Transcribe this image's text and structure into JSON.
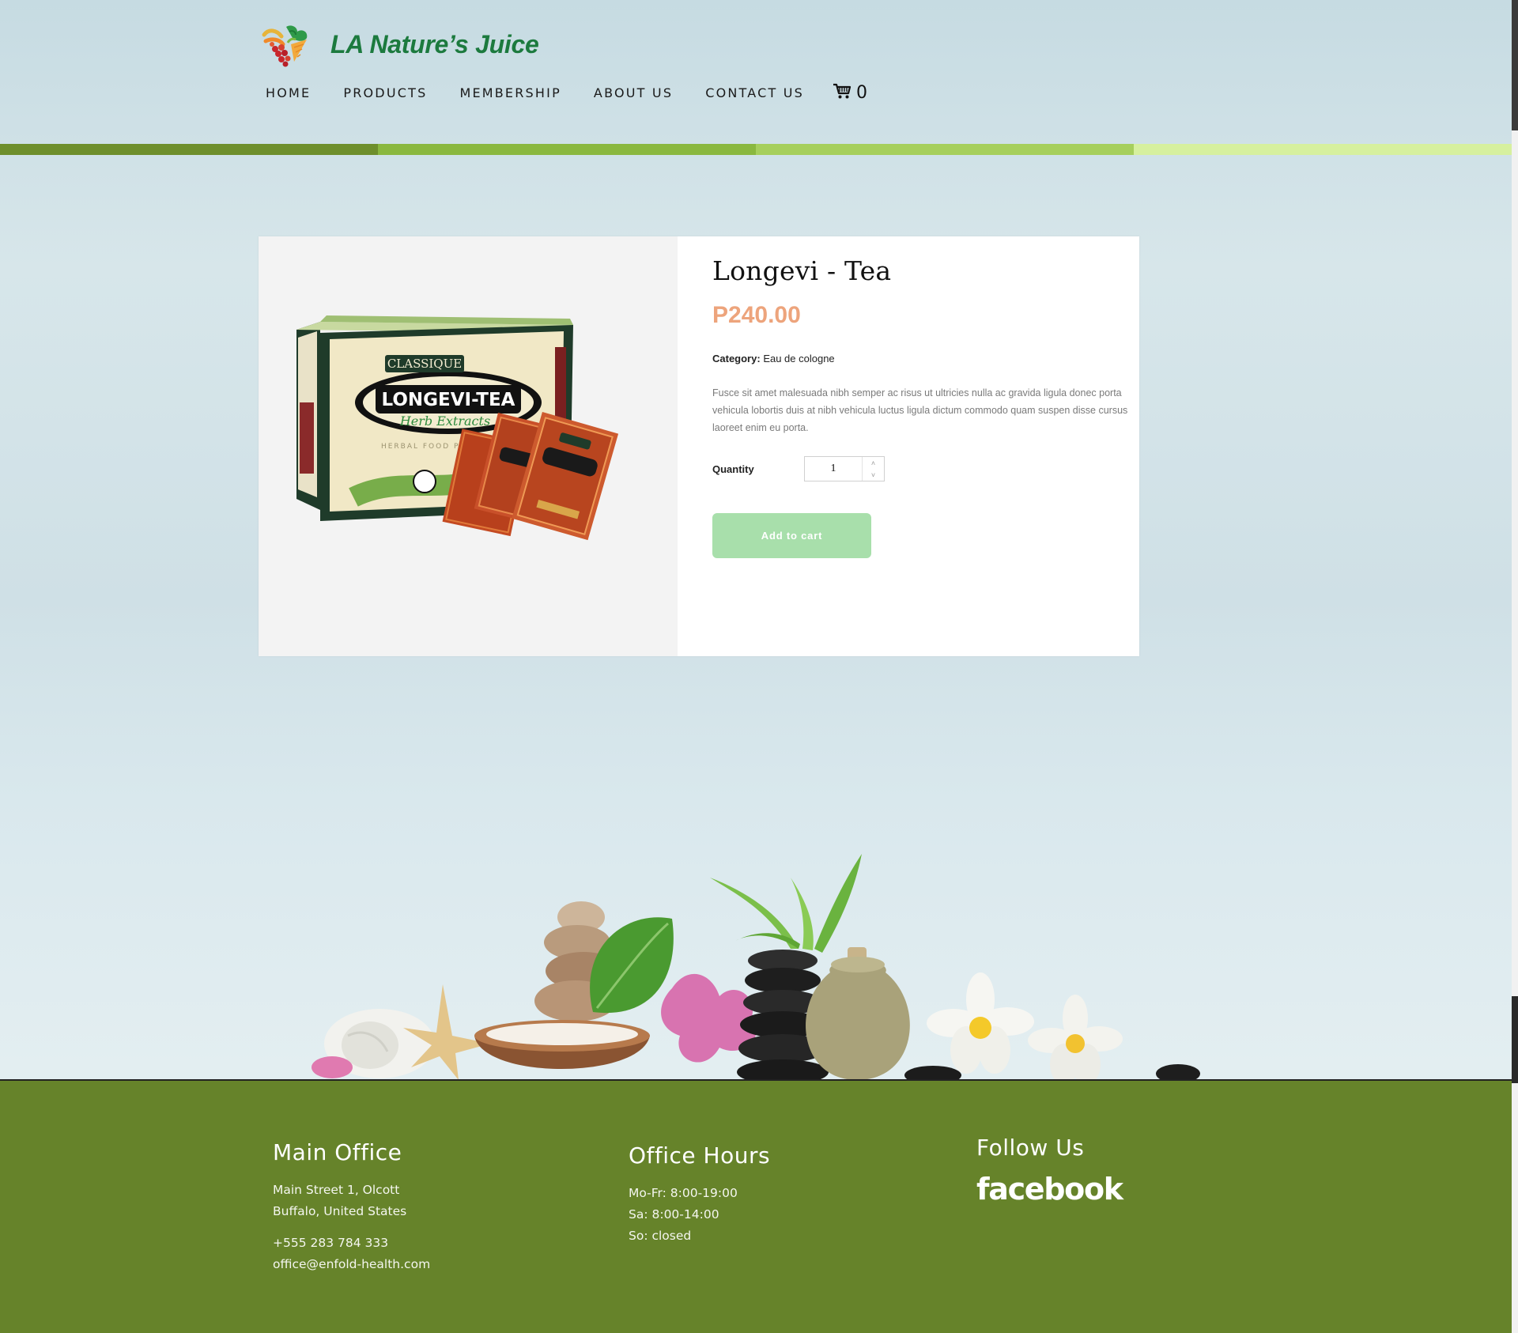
{
  "brand": {
    "name": "LA Nature’s Juice",
    "logo_icon": "fruit-heart-logo"
  },
  "nav": {
    "items": [
      {
        "label": "HOME"
      },
      {
        "label": "PRODUCTS"
      },
      {
        "label": "MEMBERSHIP"
      },
      {
        "label": "ABOUT US"
      },
      {
        "label": "CONTACT US"
      }
    ],
    "cart_icon": "cart-icon",
    "cart_count": "0"
  },
  "colors": {
    "stripe": [
      "#6e8f2c",
      "#8ab83f",
      "#a6cf5c",
      "#d6f09e"
    ],
    "price": "#eda47c",
    "button": "#a8dfab",
    "footer": "#66832a",
    "brand": "#1c7a3e"
  },
  "product": {
    "image_text": {
      "brand": "CLASSIQUE",
      "name": "LONGEVI-TEA",
      "subtitle": "Herb Extracts",
      "line": "HERBAL FOOD PRODUCT"
    },
    "title": "Longevi - Tea",
    "price": "P240.00",
    "category_label": "Category:",
    "category_value": "Eau de cologne",
    "description": "Fusce sit amet malesuada nibh semper ac risus ut ultricies nulla ac gravida ligula donec porta vehicula lobortis duis at nibh vehicula luctus ligula dictum commodo quam suspen disse cursus laoreet enim eu porta.",
    "quantity_label": "Quantity",
    "quantity_value": "1",
    "add_to_cart_label": "Add to cart"
  },
  "footer": {
    "main_office": {
      "heading": "Main Office",
      "address_line1": "Main Street 1, Olcott",
      "address_line2": "Buffalo, United States",
      "phone": "+555 283 784 333",
      "email": "office@enfold-health.com"
    },
    "office_hours": {
      "heading": "Office Hours",
      "line1": "Mo-Fr: 8:00-19:00",
      "line2": "Sa: 8:00-14:00",
      "line3": "So: closed"
    },
    "follow_us": {
      "heading": "Follow Us",
      "facebook_label": "facebook"
    }
  }
}
